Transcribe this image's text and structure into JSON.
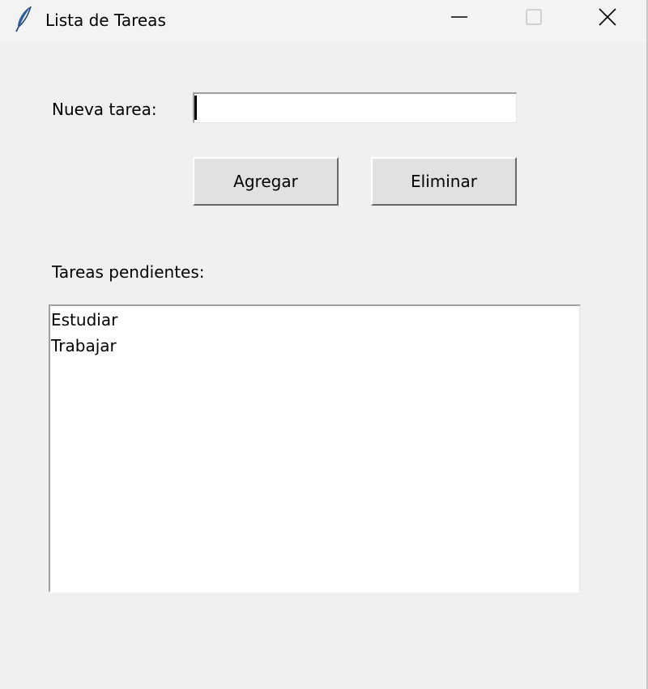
{
  "window": {
    "title": "Lista de Tareas"
  },
  "titlebar": {
    "icons": {
      "app": "feather-icon",
      "minimize": "minimize-icon",
      "maximize": "maximize-icon",
      "close": "close-icon"
    }
  },
  "form": {
    "new_task_label": "Nueva tarea:",
    "new_task_value": "",
    "add_label": "Agregar",
    "delete_label": "Eliminar"
  },
  "tasks": {
    "label": "Tareas pendientes:",
    "items": [
      "Estudiar",
      "Trabajar"
    ]
  },
  "colors": {
    "background": "#f0f0f0",
    "titlebar": "#f3f3f3",
    "field": "#ffffff",
    "button": "#e1e1e1",
    "text": "#000000",
    "feather": "#2f5f9a"
  }
}
